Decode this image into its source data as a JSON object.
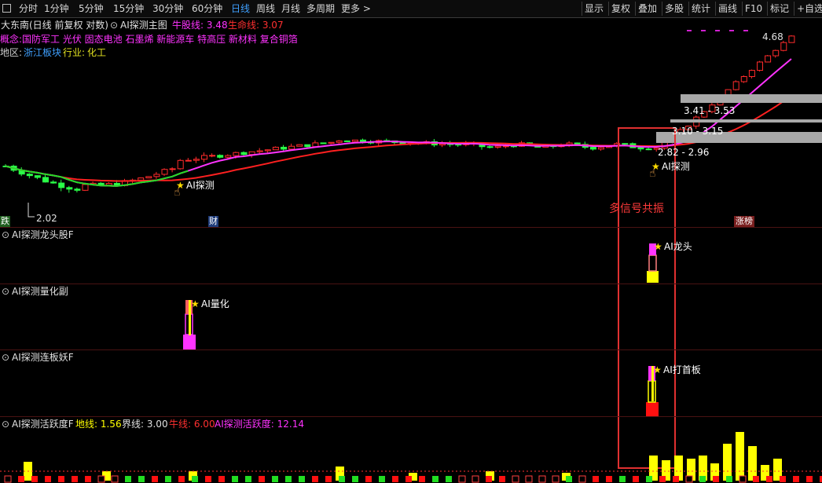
{
  "toolbar": {
    "periods": [
      {
        "label": "分时"
      },
      {
        "label": "1分钟"
      },
      {
        "label": "5分钟"
      },
      {
        "label": "15分钟"
      },
      {
        "label": "30分钟"
      },
      {
        "label": "60分钟"
      },
      {
        "label": "日线",
        "active": true
      },
      {
        "label": "周线"
      },
      {
        "label": "月线"
      },
      {
        "label": "多周期"
      },
      {
        "label": "更多 >"
      }
    ],
    "tools": [
      {
        "label": "显示"
      },
      {
        "label": "复权"
      },
      {
        "label": "叠加"
      },
      {
        "label": "多股"
      },
      {
        "label": "统计"
      },
      {
        "label": "画线"
      },
      {
        "label": "F10"
      },
      {
        "label": "标记"
      },
      {
        "label": "+自选"
      }
    ]
  },
  "main_chart": {
    "stock_title": "大东南(日线 前复权 对数)",
    "indicator_name": "AI探测主图",
    "bull_label": "牛股线: 3.48",
    "life_label": "生命线: 3.07",
    "concept": "概念:国防军工 光伏 固态电池 石墨烯 新能源车 特高压 新材料 复合铜箔",
    "region_label": "地区:",
    "region_value": "浙江板块",
    "industry_label": "行业:",
    "industry_value": "化工",
    "high_label": "4.68",
    "low_label": "2.02",
    "zone_labels": [
      "3.41 - 3.53",
      "3.10 - 3.15",
      "2.82 - 2.96"
    ],
    "ai_detect_left": "AI探测",
    "ai_detect_right": "AI探测",
    "annotation": "多信号共振",
    "tag_left": "跌",
    "tag_finance": "财",
    "tag_list": "涨榜"
  },
  "panels": {
    "dragon": {
      "title": "AI探测龙头股F",
      "signal": "AI龙头"
    },
    "quant": {
      "title": "AI探测量化副",
      "signal": "AI量化"
    },
    "limit": {
      "title": "AI探测连板妖F",
      "signal": "AI打首板"
    },
    "activity": {
      "title": "AI探测活跃度F",
      "ground": "地线: 1.56",
      "boundary": "界线: 3.00",
      "bull": "牛线: 6.00",
      "value": "AI探测活跃度: 12.14"
    }
  },
  "colors": {
    "up": "#ff2b2b",
    "down": "#29ff47",
    "magenta": "#ff33ff",
    "yellow": "#ffff00",
    "accent_blue": "#3fa0ff",
    "grid_red": "#4a1212",
    "box_red": "#e03030"
  }
}
